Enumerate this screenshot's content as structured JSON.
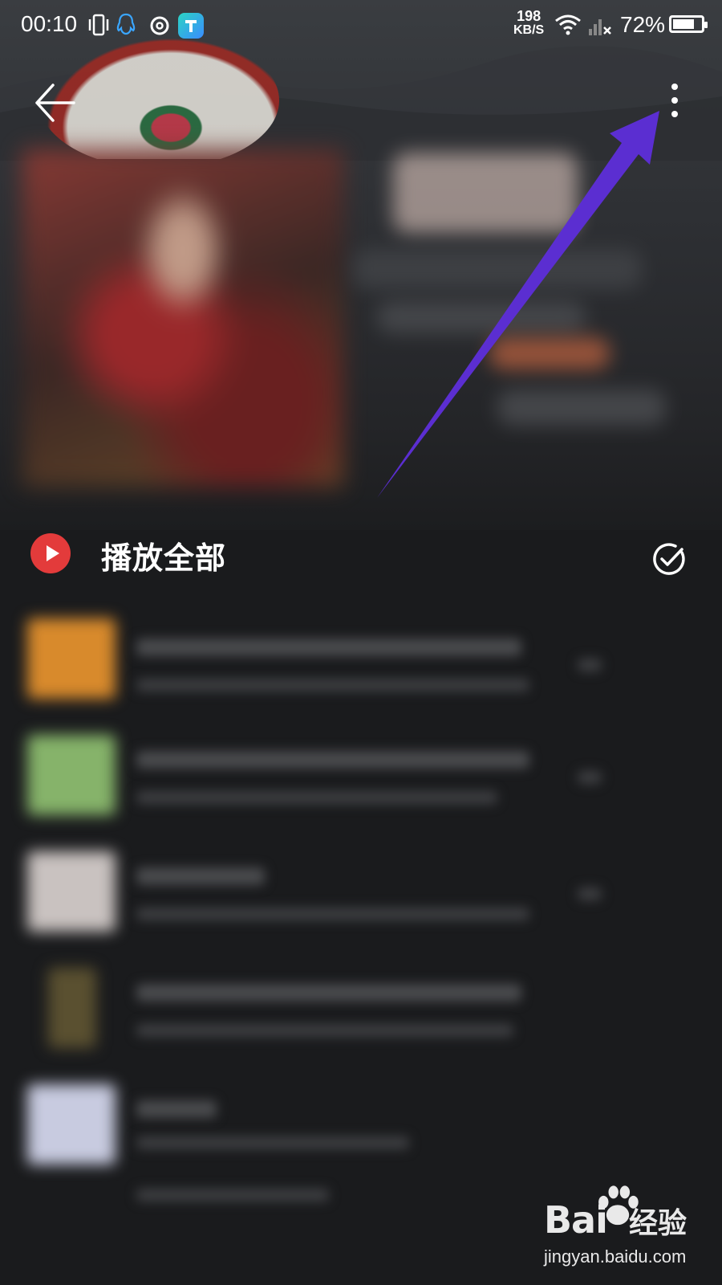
{
  "status_bar": {
    "time": "00:10",
    "net_speed_value": "198",
    "net_speed_unit": "KB/S",
    "battery_percent": "72%",
    "battery_level": 0.72
  },
  "header": {
    "back_icon": "arrow-left-icon",
    "more_icon": "more-vertical-icon"
  },
  "playlist": {
    "play_all_label": "播放全部",
    "play_icon": "play-circle-icon",
    "multi_select_icon": "check-circle-icon"
  },
  "songs": [
    {
      "thumb_color": "#d88a2c"
    },
    {
      "thumb_color": "#86b36a"
    },
    {
      "thumb_color": "#c9c2c0"
    },
    {
      "thumb_color": "#5a5030"
    },
    {
      "thumb_color": "#c8cbe0"
    }
  ],
  "annotation": {
    "arrow_color": "#5b2ed1"
  },
  "watermark": {
    "brand": "Bai",
    "brand_tail": "经验",
    "url": "jingyan.baidu.com"
  }
}
